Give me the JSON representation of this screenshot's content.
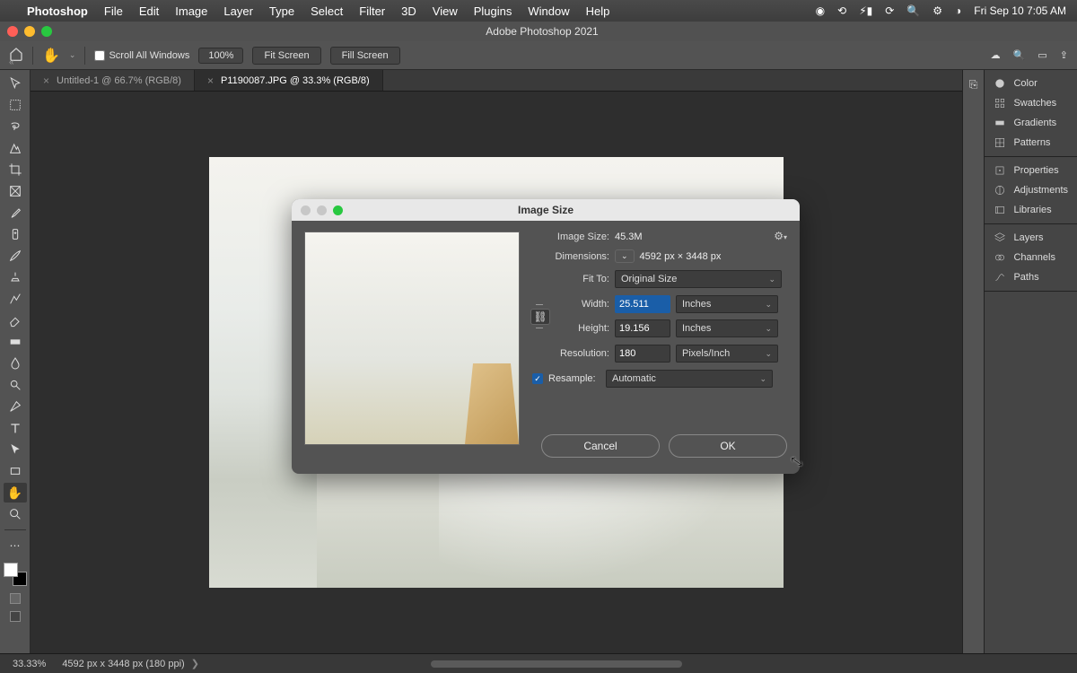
{
  "mac": {
    "app": "Photoshop",
    "menus": [
      "File",
      "Edit",
      "Image",
      "Layer",
      "Type",
      "Select",
      "Filter",
      "3D",
      "View",
      "Plugins",
      "Window",
      "Help"
    ],
    "clock": "Fri Sep 10  7:05 AM"
  },
  "window": {
    "title": "Adobe Photoshop 2021"
  },
  "options": {
    "scroll_all": "Scroll All Windows",
    "zoom": "100%",
    "fit_screen": "Fit Screen",
    "fill_screen": "Fill Screen"
  },
  "tabs": [
    {
      "label": "Untitled-1 @ 66.7% (RGB/8)",
      "active": false
    },
    {
      "label": "P1190087.JPG @ 33.3% (RGB/8)",
      "active": true
    }
  ],
  "status": {
    "zoom": "33.33%",
    "dims": "4592 px x 3448 px (180 ppi)"
  },
  "panels": {
    "g1": [
      "Color",
      "Swatches",
      "Gradients",
      "Patterns"
    ],
    "g2": [
      "Properties",
      "Adjustments",
      "Libraries"
    ],
    "g3": [
      "Layers",
      "Channels",
      "Paths"
    ]
  },
  "dialog": {
    "title": "Image Size",
    "size_label": "Image Size:",
    "size_val": "45.3M",
    "dim_label": "Dimensions:",
    "dim_val": "4592 px  ×  3448 px",
    "fit_label": "Fit To:",
    "fit_val": "Original Size",
    "width_label": "Width:",
    "width_val": "25.511",
    "width_unit": "Inches",
    "height_label": "Height:",
    "height_val": "19.156",
    "height_unit": "Inches",
    "res_label": "Resolution:",
    "res_val": "180",
    "res_unit": "Pixels/Inch",
    "resample_label": "Resample:",
    "resample_val": "Automatic",
    "cancel": "Cancel",
    "ok": "OK"
  }
}
